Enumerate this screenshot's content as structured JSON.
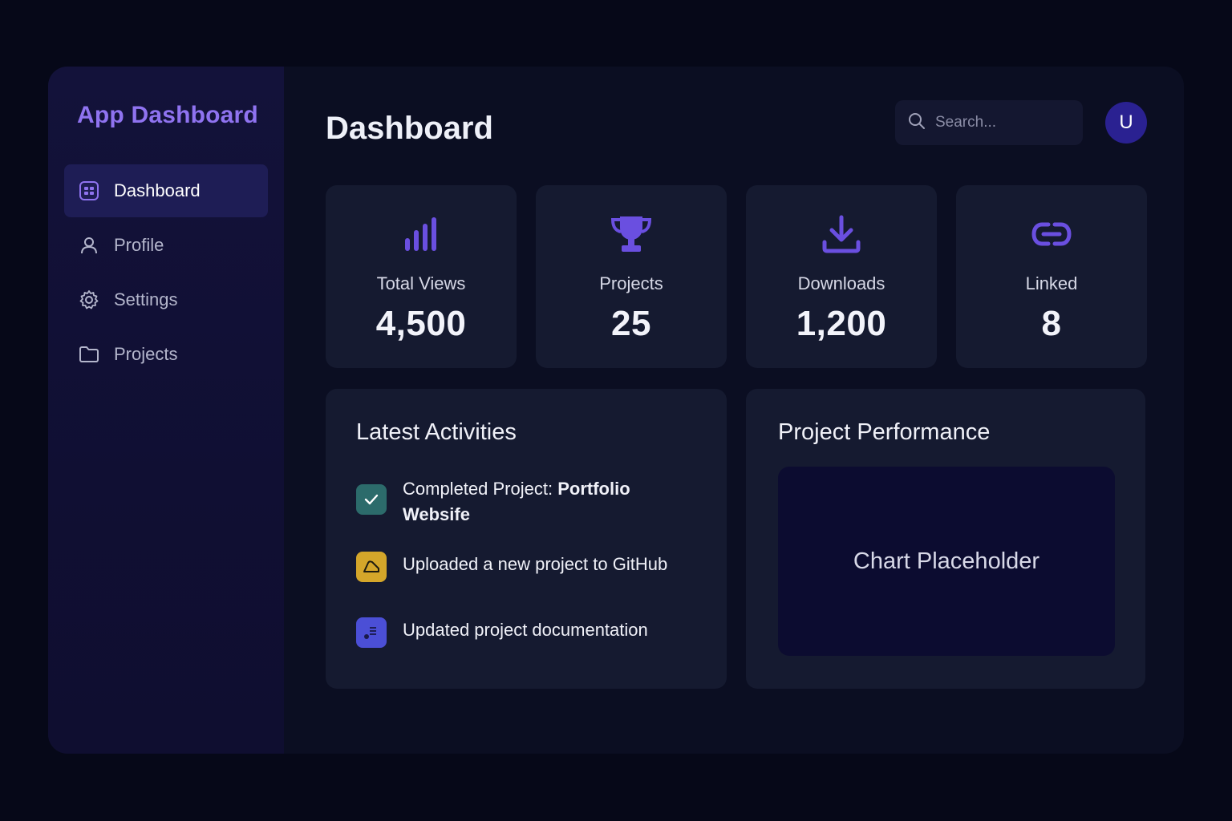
{
  "app": {
    "brand": "App Dashboard"
  },
  "sidebar": {
    "items": [
      {
        "label": "Dashboard",
        "icon": "dashboard-icon",
        "active": true
      },
      {
        "label": "Profile",
        "icon": "user-icon",
        "active": false
      },
      {
        "label": "Settings",
        "icon": "gear-icon",
        "active": false
      },
      {
        "label": "Projects",
        "icon": "folder-icon",
        "active": false
      }
    ]
  },
  "header": {
    "title": "Dashboard",
    "search_placeholder": "Search...",
    "avatar_initial": "U"
  },
  "stats": [
    {
      "label": "Total Views",
      "value": "4,500",
      "icon": "bar-chart-icon"
    },
    {
      "label": "Projects",
      "value": "25",
      "icon": "trophy-icon"
    },
    {
      "label": "Downloads",
      "value": "1,200",
      "icon": "download-icon"
    },
    {
      "label": "Linked",
      "value": "8",
      "icon": "link-icon"
    }
  ],
  "activities": {
    "title": "Latest Activities",
    "items": [
      {
        "prefix": "Completed Project: ",
        "bold": "Portfolio Websife",
        "text": "",
        "icon": "check-icon",
        "color": "#2c6b6b"
      },
      {
        "prefix": "",
        "bold": "",
        "text": "Uploaded a new project to GitHub",
        "icon": "upload-icon",
        "color": "#d4a62a"
      },
      {
        "prefix": "",
        "bold": "",
        "text": "Updated project documentation",
        "icon": "document-icon",
        "color": "#4b4fd6"
      }
    ]
  },
  "performance": {
    "title": "Project Performance",
    "placeholder": "Chart Placeholder"
  },
  "colors": {
    "accent": "#8f73f0",
    "icon_purple": "#6a4fe0",
    "card_bg": "#151a30",
    "sidebar_active": "#1e1d55"
  }
}
